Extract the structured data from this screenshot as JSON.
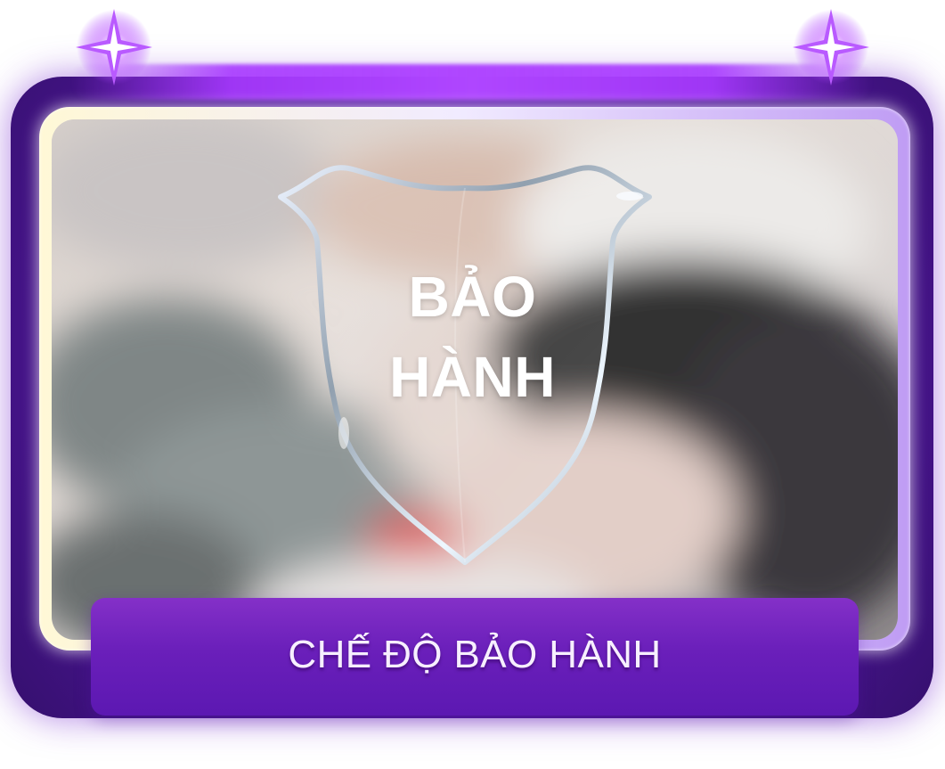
{
  "card": {
    "photo_text": {
      "line_one": "BẢO",
      "line_two": "HÀNH"
    },
    "label": "CHẾ ĐỘ BẢO HÀNH"
  },
  "colors": {
    "frame_purple": "#5c18b2",
    "accent_purple": "#a83aff",
    "label_text": "#f7efff",
    "shield_silver": "#a9b4c0"
  },
  "icons": {
    "corner_sparkles": "sparkle-icon",
    "shield": "shield-icon"
  }
}
